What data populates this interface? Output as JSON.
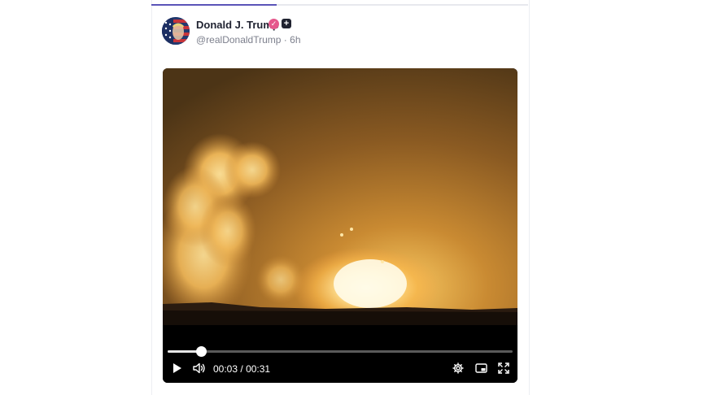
{
  "post": {
    "author_name": "Donald J. Trump",
    "verified_icon": "verified-badge-icon",
    "plus_icon": "plus-badge-icon",
    "handle": "@realDonaldTrump",
    "separator": "·",
    "age": "6h"
  },
  "video": {
    "current_time": "00:03",
    "time_separator": "/",
    "duration": "00:31",
    "progress_fraction": 0.097,
    "icons": [
      "play-icon",
      "volume-icon",
      "settings-icon",
      "picture-in-picture-icon",
      "fullscreen-icon"
    ]
  },
  "colors": {
    "accent": "#5a54b8",
    "verified": "#e5578c",
    "text": "#1f2230",
    "muted": "#7c7f8c"
  }
}
